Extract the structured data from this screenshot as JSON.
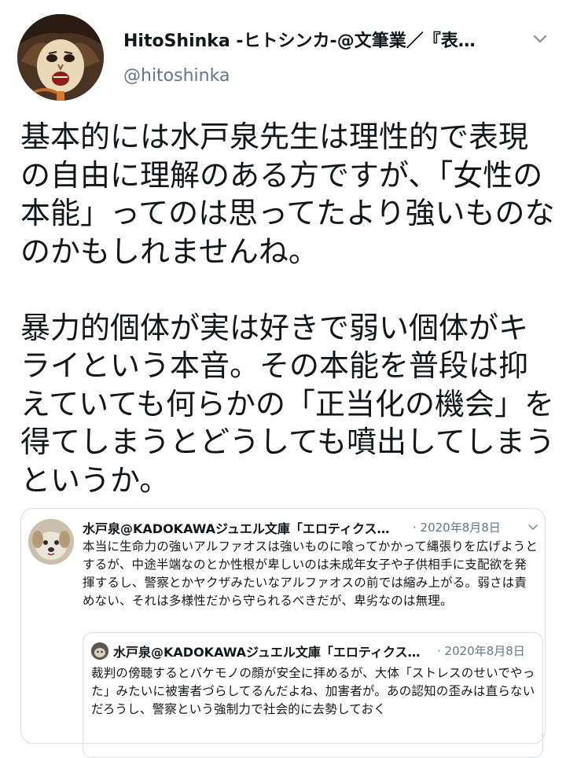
{
  "tweet": {
    "author": {
      "display_name": "HitoShinka -ヒトシンカ-@文筆業／『表…",
      "handle": "@hitoshinka"
    },
    "paragraphs": [
      "基本的には水戸泉先生は理性的で表現の自由に理解のある方ですが、「女性の本能」ってのは思ってたより強いものなのかもしれませんね。",
      "暴力的個体が実は好きで弱い個体がキライという本音。その本能を普段は抑えていても何らかの「正当化の機会」を得てしまうとどうしても噴出してしまうというか。"
    ],
    "menu_icon": "chevron-down-icon"
  },
  "quoted_tweet": {
    "author": "水戸泉@KADOKAWAジュエル文庫「エロティクス…",
    "date": "· 2020年8月8日",
    "text": "本当に生命力の強いアルファオスは強いものに喰ってかかって縄張りを広げようとするが、中途半端なのとか性根が卑しいのは未成年女子や子供相手に支配欲を発揮するし、警察とかヤクザみたいなアルファオスの前では縮み上がる。弱さは責めない、それは多様性だから守られるべきだが、卑劣なのは無理。",
    "nested": {
      "author": "水戸泉@KADOKAWAジュエル文庫「エロティクス…",
      "date": "· 2020年8月8日",
      "text": "裁判の傍聴するとバケモノの顔が安全に拝めるが、大体「ストレスのせいでやった」みたいに被害者づらしてるんだよね、加害者が。あの認知の歪みは直らないだろうし、警察という強制力で社会的に去勢しておく"
    }
  }
}
